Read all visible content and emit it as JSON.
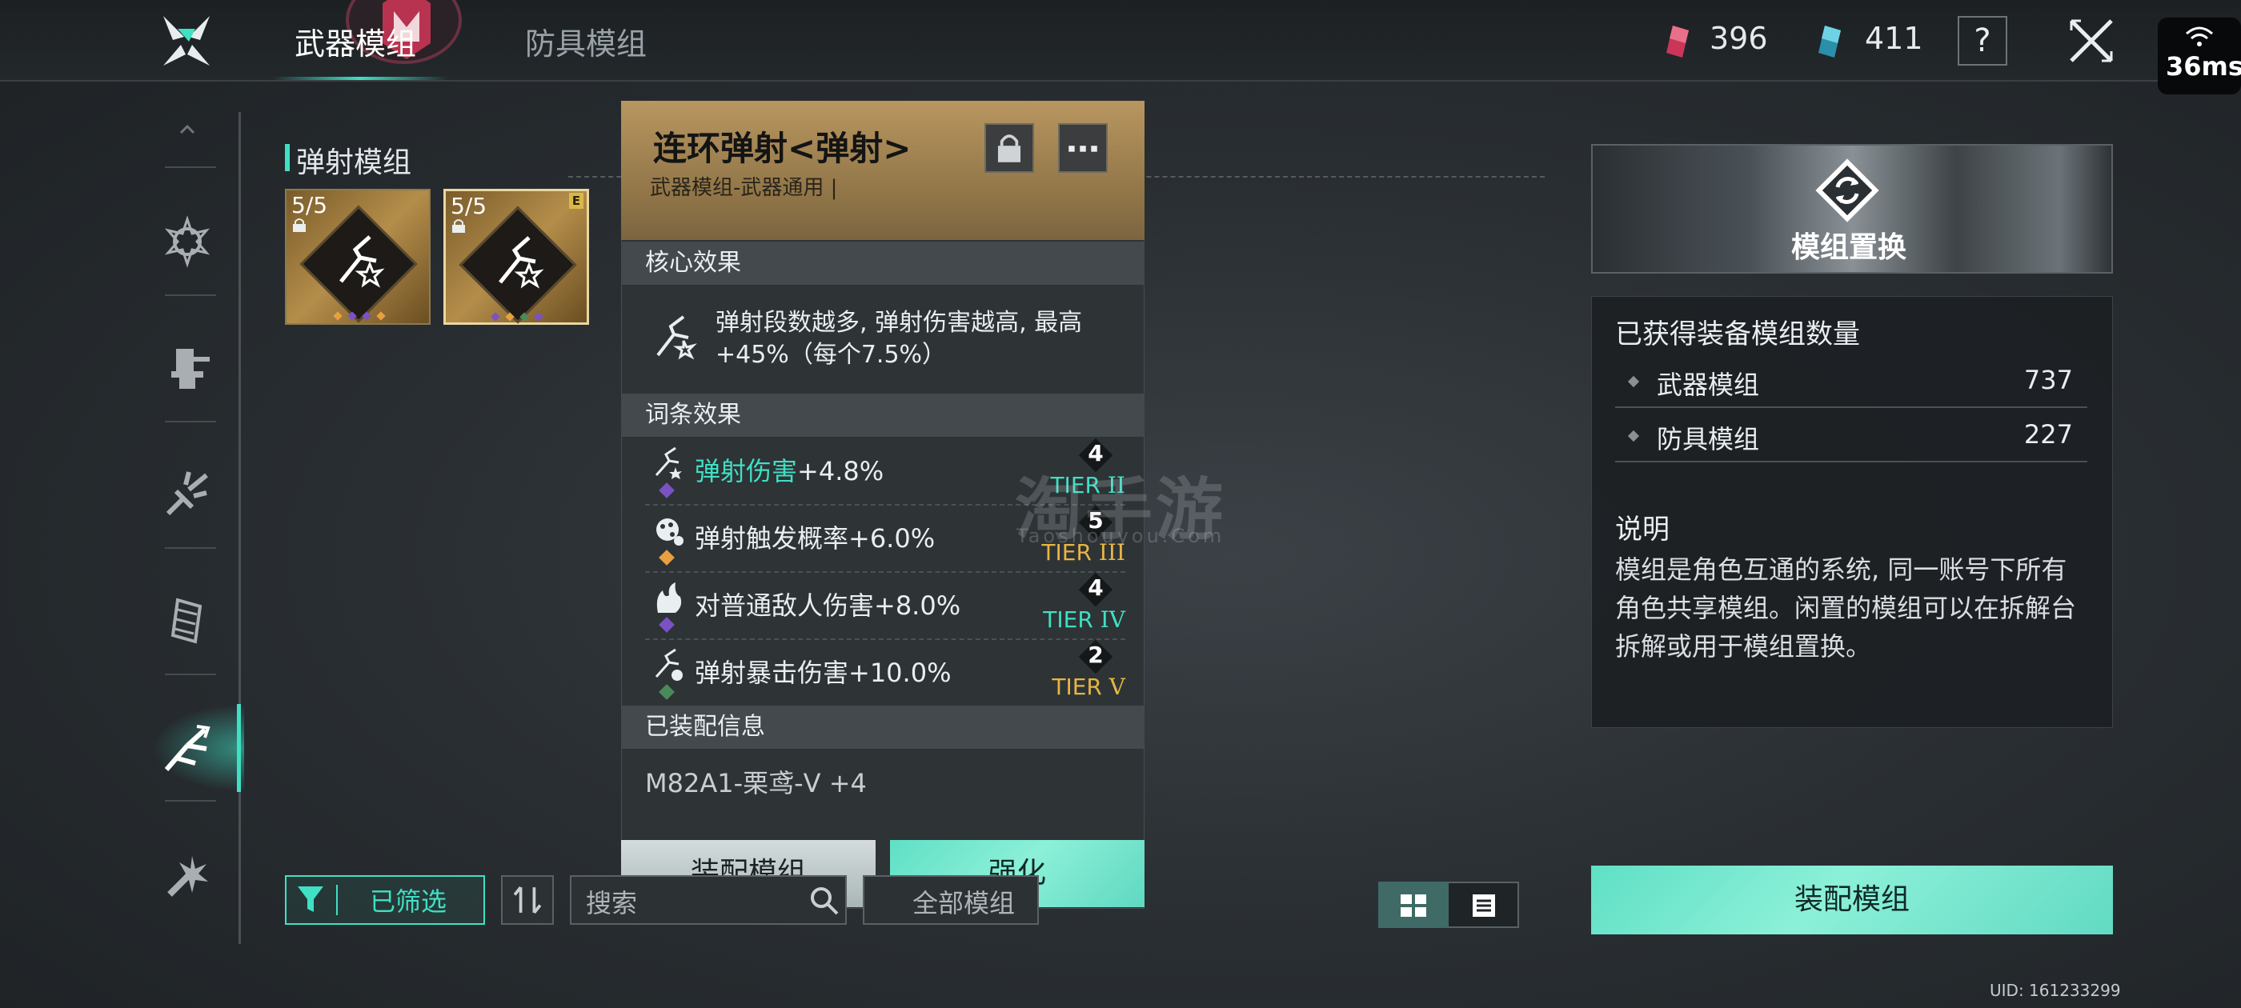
{
  "header": {
    "tabs": [
      "武器模组",
      "防具模组"
    ],
    "currency": [
      {
        "icon": "pink-crystal-icon",
        "value": "396"
      },
      {
        "icon": "blue-crystal-icon",
        "value": "411"
      }
    ],
    "help_label": "?",
    "ping": "36ms"
  },
  "section": {
    "title": "弹射模组"
  },
  "modules": [
    {
      "count": "5/5",
      "locked": true,
      "selected": false
    },
    {
      "count": "5/5",
      "locked": true,
      "selected": true,
      "badge": "E"
    }
  ],
  "detail": {
    "title": "连环弹射<弹射>",
    "subtitle": "武器模组-武器通用 |",
    "core_heading": "核心效果",
    "core_text": "弹射段数越多, 弹射伤害越高, 最高+45%（每个7.5%）",
    "stats_heading": "词条效果",
    "stats": [
      {
        "highlight": "弹射伤害",
        "rest": "+4.8%",
        "level": "4",
        "tier_prefix": "TIER ",
        "tier_num": "II",
        "tier_color": "#3fe0c4",
        "dot_color": "#7a52c4"
      },
      {
        "highlight": "",
        "rest": "弹射触发概率+6.0%",
        "level": "5",
        "tier_prefix": "TIER ",
        "tier_num": "III",
        "tier_color": "#e8b542",
        "dot_color": "#e8a042"
      },
      {
        "highlight": "",
        "rest": "对普通敌人伤害+8.0%",
        "level": "4",
        "tier_prefix": "TIER ",
        "tier_num": "IV",
        "tier_color": "#3fe0c4",
        "dot_color": "#7a52c4"
      },
      {
        "highlight": "",
        "rest": "弹射暴击伤害+10.0%",
        "level": "2",
        "tier_prefix": "TIER ",
        "tier_num": "V",
        "tier_color": "#e8b542",
        "dot_color": "#4a8a5a"
      }
    ],
    "equipped_heading": "已装配信息",
    "equipped_text": "M82A1-栗鸢-V +4",
    "equip_label": "装配模组",
    "enhance_label": "强化"
  },
  "bottom": {
    "filter_label": "已筛选",
    "search_placeholder": "搜索",
    "library_label": "全部模组"
  },
  "right": {
    "replace_label": "模组置换",
    "stats_title": "已获得装备模组数量",
    "counts": [
      {
        "label": "武器模组",
        "value": "737"
      },
      {
        "label": "防具模组",
        "value": "227"
      }
    ],
    "desc_title": "说明",
    "desc_text": "模组是角色互通的系统, 同一账号下所有角色共享模组。闲置的模组可以在拆解台拆解或用于模组置换。",
    "equip_label": "装配模组"
  },
  "uid": "UID: 161233299",
  "watermark": {
    "main": "淘手游",
    "sub": "Taoshouyou.Com"
  }
}
